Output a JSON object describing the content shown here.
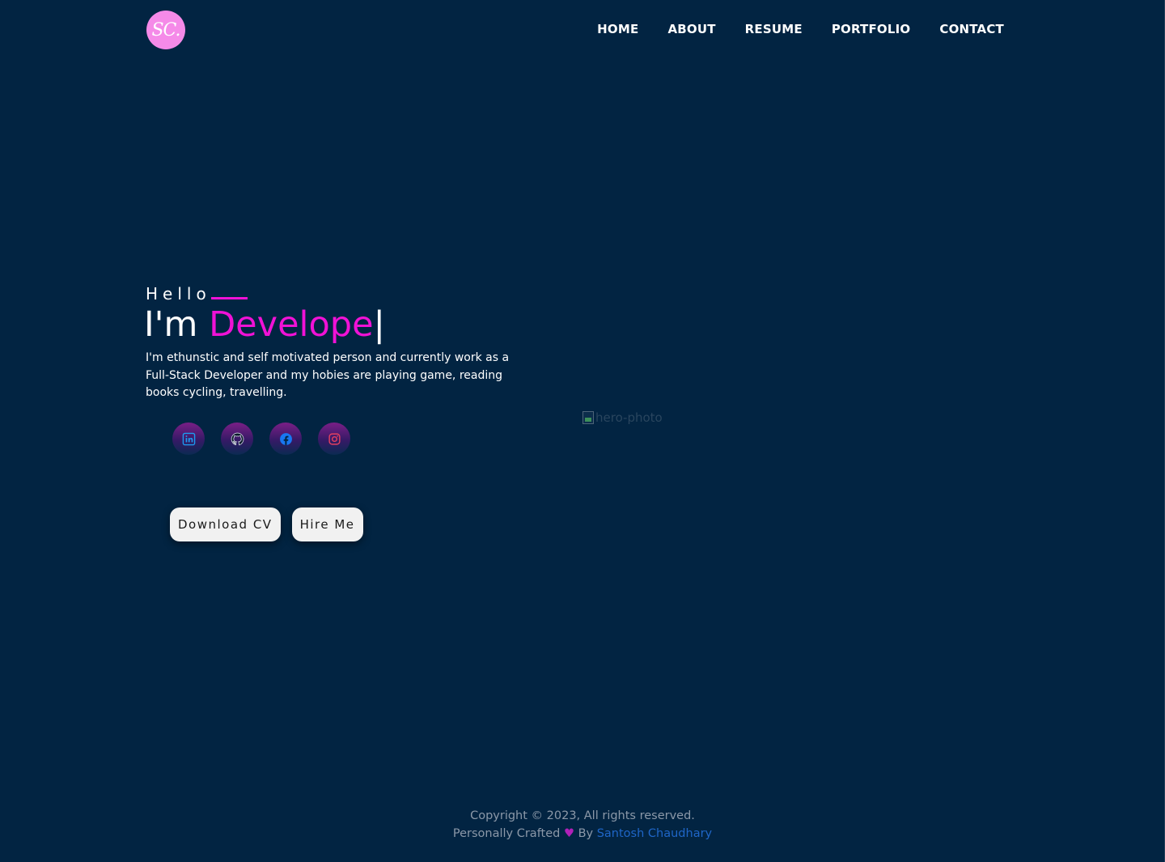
{
  "logo": {
    "text": "SC.",
    "color": "#f58ae8"
  },
  "nav": {
    "items": [
      {
        "label": "HOME"
      },
      {
        "label": "ABOUT"
      },
      {
        "label": "RESUME"
      },
      {
        "label": "PORTFOLIO"
      },
      {
        "label": "CONTACT"
      }
    ]
  },
  "hero": {
    "greeting": "Hello",
    "prefix": "I'm ",
    "role": "Develope",
    "cursor": "|",
    "intro": "I'm ethunstic and self motivated person and currently work as a Full-Stack Developer and my hobies are playing game, reading books cycling, travelling.",
    "socials": [
      {
        "icon": "linkedin-icon",
        "color": "#1d9bf0"
      },
      {
        "icon": "github-icon",
        "color": "#0b1a2c"
      },
      {
        "icon": "facebook-icon",
        "color": "#1877f2"
      },
      {
        "icon": "instagram-icon",
        "color": "#e4405f"
      }
    ],
    "buttons": {
      "download_cv": "Download CV",
      "hire_me": "Hire Me"
    },
    "image_alt": "hero-photo"
  },
  "footer": {
    "copyright": "Copyright © 2023, All rights reserved.",
    "crafted_prefix": "Personally Crafted",
    "crafted_by": "By",
    "author": "Santosh Chaudhary"
  },
  "colors": {
    "background": "#022442",
    "accent": "#f012d6",
    "link": "#1f66c8"
  }
}
